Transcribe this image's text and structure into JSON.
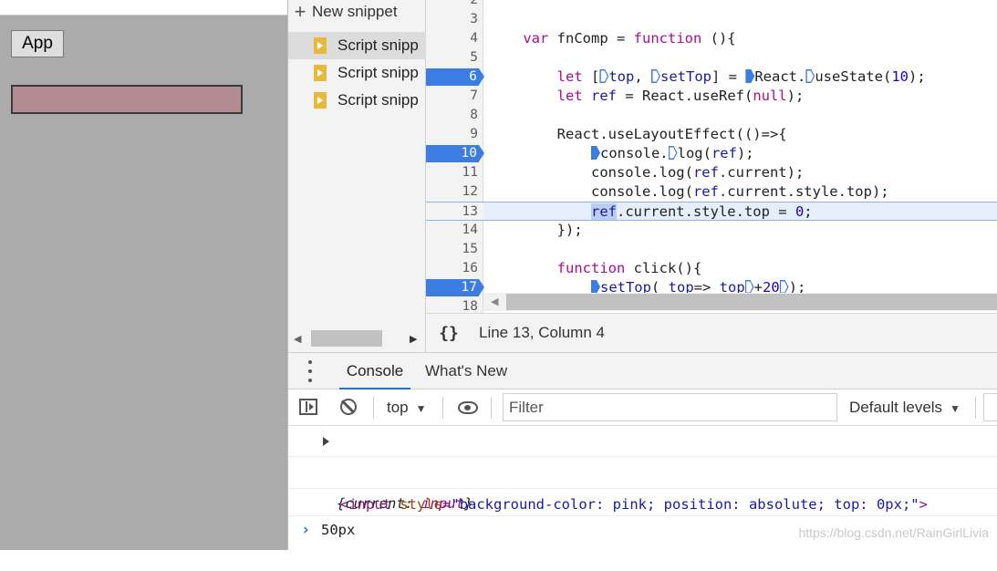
{
  "page": {
    "app_button_label": "App"
  },
  "navigator": {
    "new_snippet_label": "New snippet",
    "snippets": [
      "Script snipp",
      "Script snipp",
      "Script snipp"
    ]
  },
  "editor": {
    "lines": [
      {
        "n": "2",
        "bp": false
      },
      {
        "n": "3",
        "bp": false
      },
      {
        "n": "4",
        "bp": false
      },
      {
        "n": "5",
        "bp": false
      },
      {
        "n": "6",
        "bp": true
      },
      {
        "n": "7",
        "bp": false
      },
      {
        "n": "8",
        "bp": false
      },
      {
        "n": "9",
        "bp": false
      },
      {
        "n": "10",
        "bp": true
      },
      {
        "n": "11",
        "bp": false
      },
      {
        "n": "12",
        "bp": false
      },
      {
        "n": "13",
        "bp": false,
        "current": true
      },
      {
        "n": "14",
        "bp": false
      },
      {
        "n": "15",
        "bp": false
      },
      {
        "n": "16",
        "bp": false
      },
      {
        "n": "17",
        "bp": true
      },
      {
        "n": "18",
        "bp": false
      }
    ],
    "footer_position": "Line 13, Column 4",
    "footer_format_icon": "{}"
  },
  "drawer": {
    "tabs": [
      "Console",
      "What's New"
    ],
    "active_tab": "Console"
  },
  "console_toolbar": {
    "context": "top",
    "filter_placeholder": "Filter",
    "levels": "Default levels"
  },
  "console": {
    "msg1": {
      "open": "{",
      "key": "current:",
      "val": "input",
      "close": "}"
    },
    "msg2": {
      "tag_open": "<input",
      "attr": "style",
      "eq": "=",
      "value": "\"background-color: pink; position: absolute; top: 0px;\"",
      "tag_close": ">"
    },
    "msg3": "50px",
    "prompt": "›",
    "watermark": "https://blog.csdn.net/RainGirlLivia"
  },
  "colors": {
    "accent": "#1a73e8",
    "breakpoint": "#3b7de0",
    "snippet_icon": "#e9b93b",
    "page_bg": "#ababab",
    "pink_input": "#b48b92"
  }
}
